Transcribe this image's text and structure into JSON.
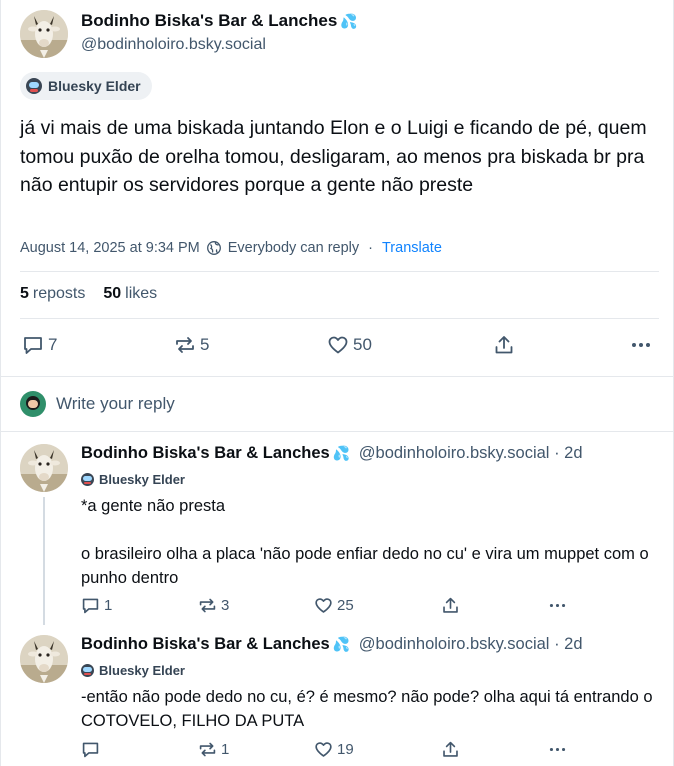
{
  "post": {
    "display_name": "Bodinho Biska's Bar & Lanches",
    "display_name_emoji": "💦",
    "handle": "@bodinholoiro.bsky.social",
    "badge": "Bluesky Elder",
    "text": "já vi mais de uma biskada juntando Elon e o Luigi e ficando de pé, quem tomou puxão de orelha tomou, desligaram, ao menos pra biskada br pra não entupir os servidores porque a gente não preste",
    "timestamp": "August 14, 2025 at 9:34 PM",
    "reply_setting": "Everybody can reply",
    "separator": "·",
    "translate": "Translate",
    "reposts_count": "5",
    "reposts_label": "reposts",
    "likes_count": "50",
    "likes_label": "likes",
    "actions": {
      "replies": "7",
      "reposts": "5",
      "likes": "50"
    }
  },
  "composer": {
    "placeholder": "Write your reply"
  },
  "replies": [
    {
      "display_name": "Bodinho Biska's Bar & Lanches",
      "display_name_emoji": "💦",
      "handle": "@bodinholoiro.bsky.social",
      "age": "· 2d",
      "badge": "Bluesky Elder",
      "text_line1": "*a gente não presta",
      "text_line2": "o brasileiro olha a placa 'não pode enfiar dedo no cu' e vira um muppet com o punho dentro",
      "actions": {
        "replies": "1",
        "reposts": "3",
        "likes": "25"
      }
    },
    {
      "display_name": "Bodinho Biska's Bar & Lanches",
      "display_name_emoji": "💦",
      "handle": "@bodinholoiro.bsky.social",
      "age": "· 2d",
      "badge": "Bluesky Elder",
      "text_line1": "-então não pode dedo no cu, é? é mesmo? não pode? olha aqui tá entrando o COTOVELO, FILHO DA PUTA",
      "actions": {
        "replies": "",
        "reposts": "1",
        "likes": "19"
      }
    }
  ],
  "icons": {
    "reply": "speech-bubble-icon",
    "repost": "repost-arrows-icon",
    "like": "heart-icon",
    "share": "share-icon",
    "more": "ellipsis-icon",
    "globe": "globe-icon"
  },
  "colors": {
    "link": "#1083fe",
    "muted": "#42576c",
    "text": "#0b0f14",
    "divider": "#e5e8ec"
  }
}
